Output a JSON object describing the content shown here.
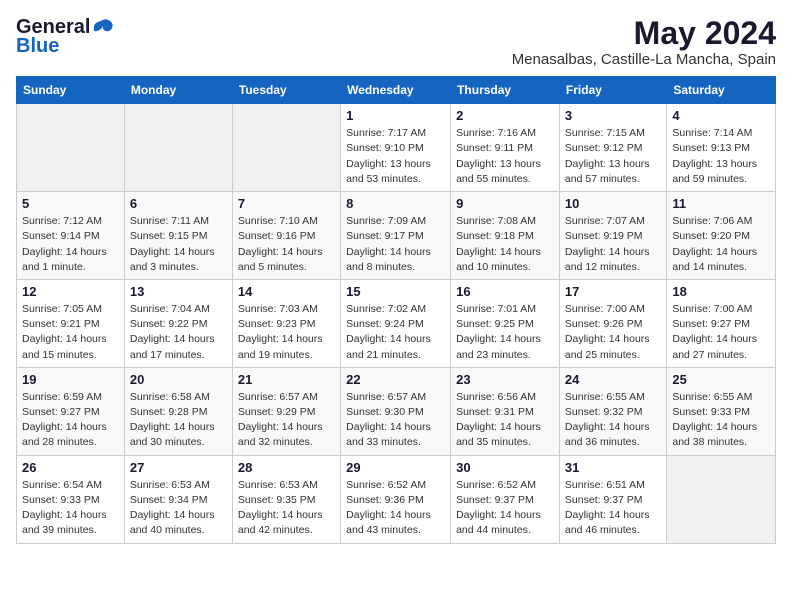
{
  "logo": {
    "general": "General",
    "blue": "Blue"
  },
  "title": "May 2024",
  "location": "Menasalbas, Castille-La Mancha, Spain",
  "days_of_week": [
    "Sunday",
    "Monday",
    "Tuesday",
    "Wednesday",
    "Thursday",
    "Friday",
    "Saturday"
  ],
  "weeks": [
    [
      {
        "day": "",
        "info": ""
      },
      {
        "day": "",
        "info": ""
      },
      {
        "day": "",
        "info": ""
      },
      {
        "day": "1",
        "info": "Sunrise: 7:17 AM\nSunset: 9:10 PM\nDaylight: 13 hours and 53 minutes."
      },
      {
        "day": "2",
        "info": "Sunrise: 7:16 AM\nSunset: 9:11 PM\nDaylight: 13 hours and 55 minutes."
      },
      {
        "day": "3",
        "info": "Sunrise: 7:15 AM\nSunset: 9:12 PM\nDaylight: 13 hours and 57 minutes."
      },
      {
        "day": "4",
        "info": "Sunrise: 7:14 AM\nSunset: 9:13 PM\nDaylight: 13 hours and 59 minutes."
      }
    ],
    [
      {
        "day": "5",
        "info": "Sunrise: 7:12 AM\nSunset: 9:14 PM\nDaylight: 14 hours and 1 minute."
      },
      {
        "day": "6",
        "info": "Sunrise: 7:11 AM\nSunset: 9:15 PM\nDaylight: 14 hours and 3 minutes."
      },
      {
        "day": "7",
        "info": "Sunrise: 7:10 AM\nSunset: 9:16 PM\nDaylight: 14 hours and 5 minutes."
      },
      {
        "day": "8",
        "info": "Sunrise: 7:09 AM\nSunset: 9:17 PM\nDaylight: 14 hours and 8 minutes."
      },
      {
        "day": "9",
        "info": "Sunrise: 7:08 AM\nSunset: 9:18 PM\nDaylight: 14 hours and 10 minutes."
      },
      {
        "day": "10",
        "info": "Sunrise: 7:07 AM\nSunset: 9:19 PM\nDaylight: 14 hours and 12 minutes."
      },
      {
        "day": "11",
        "info": "Sunrise: 7:06 AM\nSunset: 9:20 PM\nDaylight: 14 hours and 14 minutes."
      }
    ],
    [
      {
        "day": "12",
        "info": "Sunrise: 7:05 AM\nSunset: 9:21 PM\nDaylight: 14 hours and 15 minutes."
      },
      {
        "day": "13",
        "info": "Sunrise: 7:04 AM\nSunset: 9:22 PM\nDaylight: 14 hours and 17 minutes."
      },
      {
        "day": "14",
        "info": "Sunrise: 7:03 AM\nSunset: 9:23 PM\nDaylight: 14 hours and 19 minutes."
      },
      {
        "day": "15",
        "info": "Sunrise: 7:02 AM\nSunset: 9:24 PM\nDaylight: 14 hours and 21 minutes."
      },
      {
        "day": "16",
        "info": "Sunrise: 7:01 AM\nSunset: 9:25 PM\nDaylight: 14 hours and 23 minutes."
      },
      {
        "day": "17",
        "info": "Sunrise: 7:00 AM\nSunset: 9:26 PM\nDaylight: 14 hours and 25 minutes."
      },
      {
        "day": "18",
        "info": "Sunrise: 7:00 AM\nSunset: 9:27 PM\nDaylight: 14 hours and 27 minutes."
      }
    ],
    [
      {
        "day": "19",
        "info": "Sunrise: 6:59 AM\nSunset: 9:27 PM\nDaylight: 14 hours and 28 minutes."
      },
      {
        "day": "20",
        "info": "Sunrise: 6:58 AM\nSunset: 9:28 PM\nDaylight: 14 hours and 30 minutes."
      },
      {
        "day": "21",
        "info": "Sunrise: 6:57 AM\nSunset: 9:29 PM\nDaylight: 14 hours and 32 minutes."
      },
      {
        "day": "22",
        "info": "Sunrise: 6:57 AM\nSunset: 9:30 PM\nDaylight: 14 hours and 33 minutes."
      },
      {
        "day": "23",
        "info": "Sunrise: 6:56 AM\nSunset: 9:31 PM\nDaylight: 14 hours and 35 minutes."
      },
      {
        "day": "24",
        "info": "Sunrise: 6:55 AM\nSunset: 9:32 PM\nDaylight: 14 hours and 36 minutes."
      },
      {
        "day": "25",
        "info": "Sunrise: 6:55 AM\nSunset: 9:33 PM\nDaylight: 14 hours and 38 minutes."
      }
    ],
    [
      {
        "day": "26",
        "info": "Sunrise: 6:54 AM\nSunset: 9:33 PM\nDaylight: 14 hours and 39 minutes."
      },
      {
        "day": "27",
        "info": "Sunrise: 6:53 AM\nSunset: 9:34 PM\nDaylight: 14 hours and 40 minutes."
      },
      {
        "day": "28",
        "info": "Sunrise: 6:53 AM\nSunset: 9:35 PM\nDaylight: 14 hours and 42 minutes."
      },
      {
        "day": "29",
        "info": "Sunrise: 6:52 AM\nSunset: 9:36 PM\nDaylight: 14 hours and 43 minutes."
      },
      {
        "day": "30",
        "info": "Sunrise: 6:52 AM\nSunset: 9:37 PM\nDaylight: 14 hours and 44 minutes."
      },
      {
        "day": "31",
        "info": "Sunrise: 6:51 AM\nSunset: 9:37 PM\nDaylight: 14 hours and 46 minutes."
      },
      {
        "day": "",
        "info": ""
      }
    ]
  ]
}
